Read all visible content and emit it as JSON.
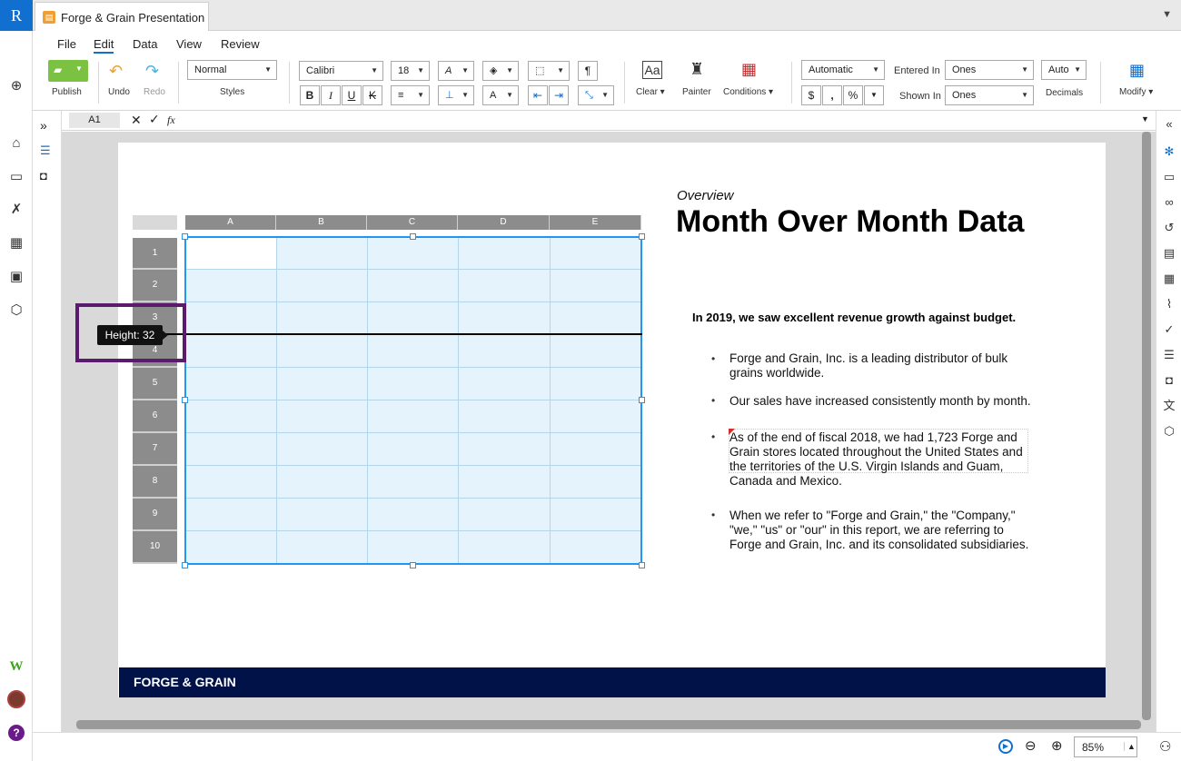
{
  "app": {
    "logo": "R",
    "doc_title": "Forge & Grain Presentation"
  },
  "menu": {
    "items": [
      "File",
      "Edit",
      "Data",
      "View",
      "Review"
    ],
    "active": "Edit"
  },
  "ribbon": {
    "publish": "Publish",
    "undo": "Undo",
    "redo": "Redo",
    "style_value": "Normal",
    "styles_label": "Styles",
    "font": "Calibri",
    "size": "18",
    "clear": "Clear",
    "painter": "Painter",
    "conditions": "Conditions",
    "number_format": "Automatic",
    "entered_in_label": "Entered In",
    "entered_in": "Ones",
    "shown_in_label": "Shown In",
    "shown_in": "Ones",
    "decimals_value": "Auto",
    "decimals_label": "Decimals",
    "modify": "Modify",
    "bold": "B",
    "italic": "I",
    "underline": "U",
    "strike": "K",
    "dollar": "$",
    "comma": ",",
    "percent": "%",
    "pilcrow": "¶"
  },
  "formula": {
    "cell": "A1",
    "fx": "fx"
  },
  "grid": {
    "columns": [
      "A",
      "B",
      "C",
      "D",
      "E"
    ],
    "rows": [
      "1",
      "2",
      "3",
      "4",
      "5",
      "6",
      "7",
      "8",
      "9",
      "10"
    ],
    "tooltip": "Height: 32"
  },
  "slide": {
    "overview": "Overview",
    "title": "Month Over Month Data",
    "intro": "In 2019, we saw excellent revenue growth against budget.",
    "bullets": [
      "Forge and Grain, Inc. is a leading distributor of bulk grains worldwide.",
      "Our sales have increased consistently month by month.",
      "As of the end of fiscal 2018, we had 1,723 Forge and Grain stores located throughout the United States and the territories of the U.S. Virgin Islands and Guam, Canada and Mexico.",
      "When we refer to \"Forge and Grain,\" the \"Company,\" \"we,\" \"us\" or \"our\" in this report, we are referring to Forge and Grain, Inc. and its consolidated subsidiaries."
    ],
    "footer": "FORGE & GRAIN"
  },
  "status": {
    "zoom": "85%"
  },
  "icons": [
    "add-icon",
    "home-icon",
    "folder-icon",
    "tasks-icon",
    "calendar-icon",
    "certificate-icon",
    "package-icon",
    "workiva-icon",
    "avatar",
    "help-icon",
    "settings-icon",
    "comment-icon",
    "link-icon",
    "history-icon",
    "formula-icon",
    "table-icon",
    "attachment-icon",
    "check-icon",
    "list-icon",
    "bookmark-icon",
    "translate-icon",
    "cube-icon",
    "play-icon",
    "zoom-out-icon",
    "zoom-in-icon",
    "user-icon"
  ]
}
